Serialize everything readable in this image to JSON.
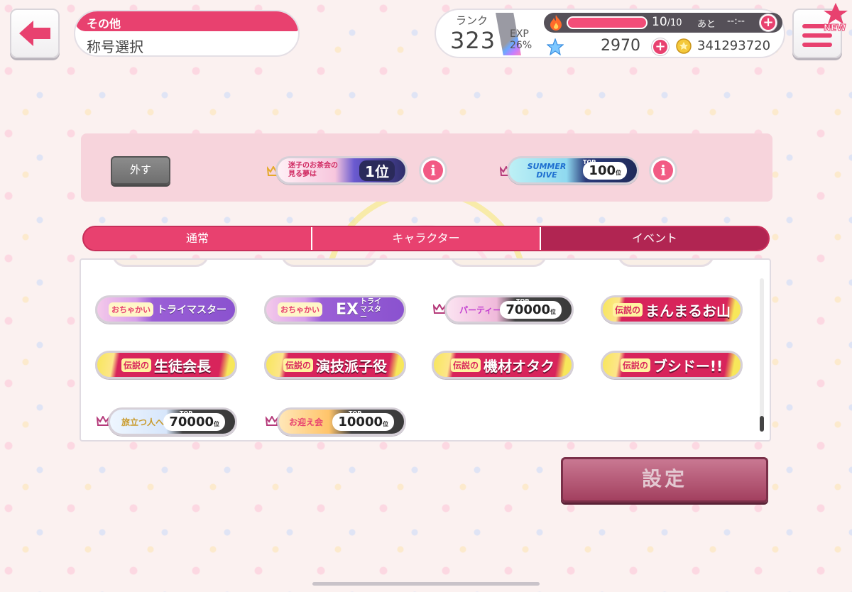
{
  "header": {
    "category": "その他",
    "title": "称号選択"
  },
  "status": {
    "rank_label": "ランク",
    "rank": "323",
    "exp_label": "EXP",
    "exp_percent": "26%",
    "stamina": "10",
    "stamina_max": "/10",
    "stamina_progress": 1.0,
    "ato_label": "あと",
    "timer": "--:--",
    "gems": "2970",
    "coins": "341293720",
    "new_badge": "NEW"
  },
  "equipped": {
    "remove_label": "外す",
    "badges": [
      {
        "type": "event",
        "text": "迷子のお茶会の見る夢は",
        "rank": "1位"
      },
      {
        "type": "event",
        "text": "SUMMER DIVE",
        "top_label": "TOP",
        "rank": "100",
        "rank_suffix": "位"
      }
    ]
  },
  "tabs": [
    {
      "label": "通常",
      "active": false
    },
    {
      "label": "キャラクター",
      "active": false
    },
    {
      "label": "イベント",
      "active": true
    }
  ],
  "grid": {
    "rows": [
      [
        {
          "style": "purple",
          "icon_text": "おちゃかい",
          "label": "トライマスター"
        },
        {
          "style": "purple-ex",
          "icon_text": "おちゃかい",
          "ex": "EX",
          "label": "トライ マスター"
        },
        {
          "style": "rank",
          "crown": true,
          "text": "パーティー",
          "top_label": "TOP",
          "rank": "70000",
          "rank_suffix": "位"
        },
        {
          "style": "legend",
          "prefix": "伝説の",
          "label": "まんまるお山"
        }
      ],
      [
        {
          "style": "legend",
          "prefix": "伝説の",
          "label": "生徒会長"
        },
        {
          "style": "legend",
          "prefix": "伝説の",
          "label": "演技派子役"
        },
        {
          "style": "legend",
          "prefix": "伝説の",
          "label": "機材オタク"
        },
        {
          "style": "legend",
          "prefix": "伝説の",
          "label": "ブシドー!!"
        }
      ],
      [
        {
          "style": "rank",
          "crown": true,
          "text": "旅立つ人へ",
          "top_label": "TOP",
          "rank": "70000",
          "rank_suffix": "位"
        },
        {
          "style": "rank",
          "crown": true,
          "text": "お迎え会",
          "top_label": "TOP",
          "rank": "10000",
          "rank_suffix": "位"
        }
      ]
    ]
  },
  "set_button": "設定",
  "colors": {
    "accent": "#e8416f",
    "accent_dark": "#b12552",
    "set_button": "#a3405f",
    "legend_red": "#d8245b",
    "legend_yellow": "#f7e75a",
    "purple": "#8a52cf"
  }
}
